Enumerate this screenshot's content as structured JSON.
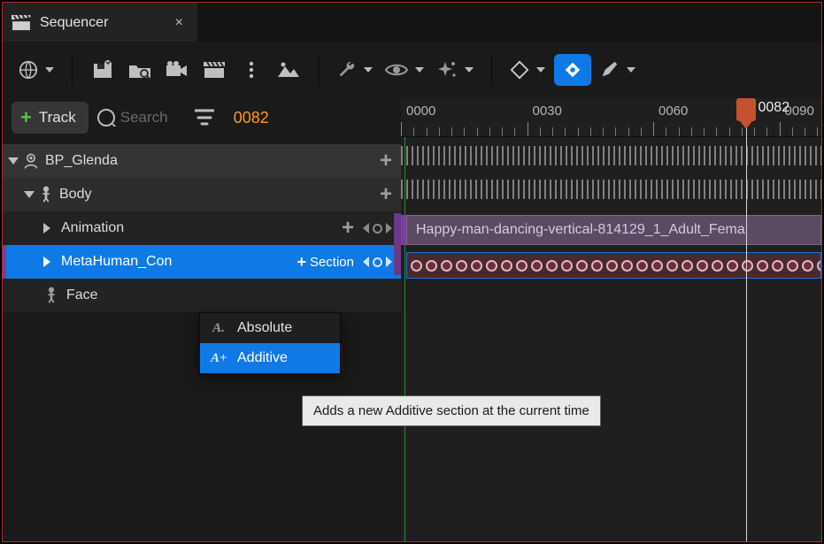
{
  "tab": {
    "title": "Sequencer",
    "close": "×"
  },
  "toolbar": {
    "frame": "0082"
  },
  "trackbar": {
    "track_label": "Track",
    "search_placeholder": "Search"
  },
  "tree": {
    "root": "BP_Glenda",
    "body": "Body",
    "anim": "Animation",
    "meta": "MetaHuman_Con",
    "section_btn": "Section",
    "face": "Face"
  },
  "timeline": {
    "labels": [
      "0000",
      "0030",
      "0060",
      "0090"
    ],
    "playhead_frame": "0082",
    "clip_name": "Happy-man-dancing-vertical-814129_1_Adult_Fema"
  },
  "menu": {
    "absolute": "Absolute",
    "additive": "Additive"
  },
  "tooltip": "Adds a new Additive section at the current time"
}
